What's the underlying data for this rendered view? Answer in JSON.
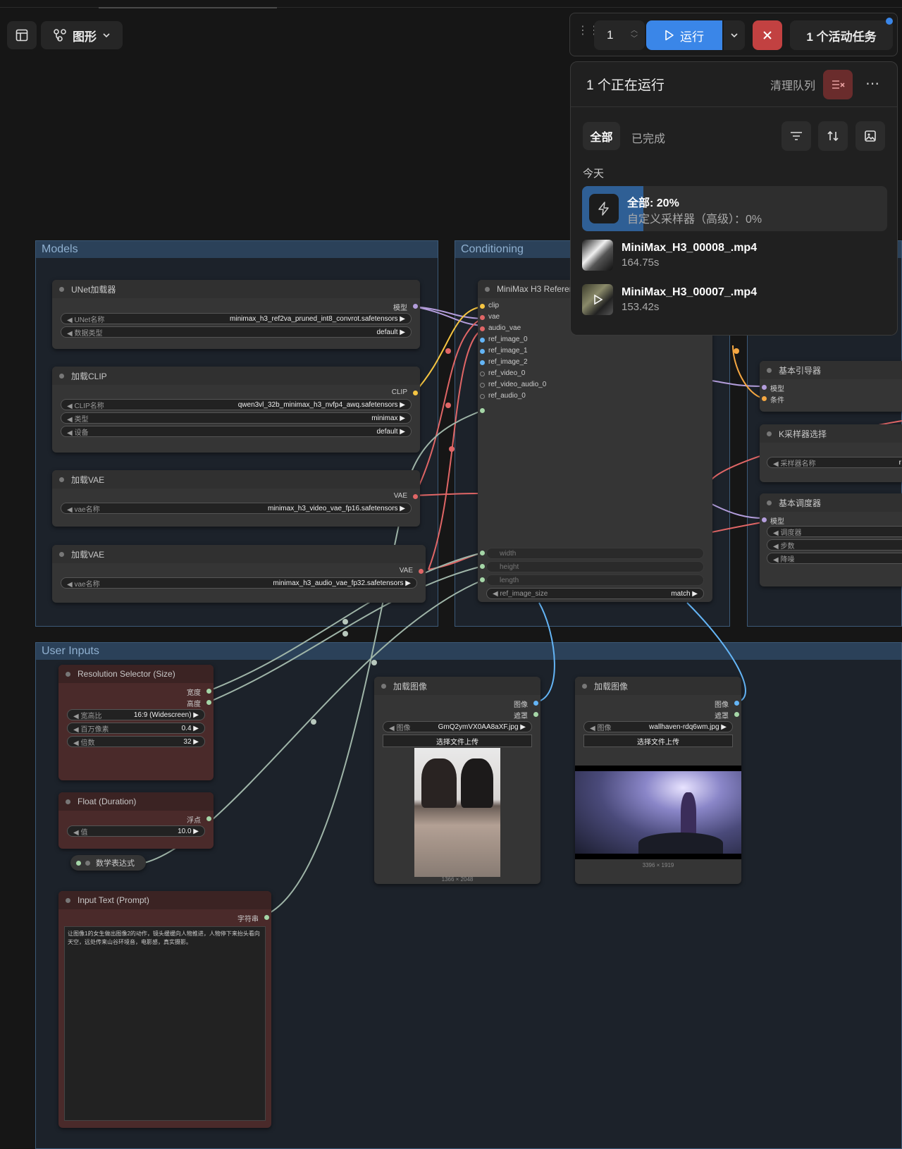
{
  "toolbar": {
    "view_label": "图形",
    "batch_count": "1",
    "run_label": "运行",
    "active_tasks": "1 个活动任务"
  },
  "queue": {
    "title": "1 个正在运行",
    "clear_label": "清理队列",
    "tabs": [
      "全部",
      "已完成"
    ],
    "section": "今天",
    "running": {
      "title": "全部: 20%",
      "subtitle": "自定义采样器（高级）：0%",
      "progress": 0.2
    },
    "items": [
      {
        "name": "MiniMax_H3_00008_.mp4",
        "time": "164.75s"
      },
      {
        "name": "MiniMax_H3_00007_.mp4",
        "time": "153.42s"
      }
    ]
  },
  "groups": {
    "models": "Models",
    "conditioning": "Conditioning",
    "user_inputs": "User Inputs"
  },
  "nodes": {
    "unet": {
      "title": "UNet加载器",
      "out": "模型",
      "w1l": "UNet名称",
      "w1v": "minimax_h3_ref2va_pruned_int8_convrot.safetensors",
      "w2l": "数据类型",
      "w2v": "default"
    },
    "clip": {
      "title": "加载CLIP",
      "out": "CLIP",
      "w1l": "CLIP名称",
      "w1v": "qwen3vl_32b_minimax_h3_nvfp4_awq.safetensors",
      "w2l": "类型",
      "w2v": "minimax",
      "w3l": "设备",
      "w3v": "default"
    },
    "vae1": {
      "title": "加载VAE",
      "out": "VAE",
      "w1l": "vae名称",
      "w1v": "minimax_h3_video_vae_fp16.safetensors"
    },
    "vae2": {
      "title": "加载VAE",
      "out": "VAE",
      "w1l": "vae名称",
      "w1v": "minimax_h3_audio_vae_fp32.safetensors"
    },
    "minimax": {
      "title": "MiniMax H3 Referen",
      "inputs": [
        "clip",
        "vae",
        "audio_vae",
        "ref_image_0",
        "ref_image_1",
        "ref_image_2",
        "ref_video_0",
        "ref_video_audio_0",
        "ref_audio_0"
      ],
      "w_width": "width",
      "w_height": "height",
      "w_length": "length",
      "w_ref": "ref_image_size",
      "w_ref_v": "match"
    },
    "guider": {
      "title": "基本引导器",
      "in1": "模型",
      "in2": "条件"
    },
    "ksampler": {
      "title": "K采样器选择",
      "w1l": "采样器名称",
      "w1v": "r"
    },
    "scheduler": {
      "title": "基本调度器",
      "in1": "模型",
      "w1": "调度器",
      "w2": "步数",
      "w3": "降噪"
    },
    "resolution": {
      "title": "Resolution Selector (Size)",
      "out1": "宽度",
      "out2": "高度",
      "w1l": "宽高比",
      "w1v": "16:9 (Widescreen)",
      "w2l": "百万像素",
      "w2v": "0.4",
      "w3l": "倍数",
      "w3v": "32"
    },
    "float": {
      "title": "Float (Duration)",
      "out": "浮点",
      "w1l": "值",
      "w1v": "10.0"
    },
    "math": {
      "title": "数学表达式"
    },
    "prompt": {
      "title": "Input Text (Prompt)",
      "out": "字符串",
      "text": "让图像1的女生做出图像2的动作，镜头缓缓向人物推进，人物停下来抬头看向天空，远处传来山谷环境音，电影感，真实摄影。"
    },
    "img1": {
      "title": "加载图像",
      "out1": "图像",
      "out2": "遮罩",
      "w1l": "图像",
      "w1v": "GmQ2ymVX0AA8aXF.jpg",
      "upload": "选择文件上传",
      "size": "1366 × 2048"
    },
    "img2": {
      "title": "加载图像",
      "out1": "图像",
      "out2": "遮罩",
      "w1l": "图像",
      "w1v": "wallhaven-rdq6wm.jpg",
      "upload": "选择文件上传",
      "size": "3396 × 1919"
    }
  },
  "colors": {
    "run": "#3a86e8",
    "stop": "#c24141",
    "wire_clip": "#f5c542",
    "wire_vae": "#e06666",
    "wire_model": "#b39ddb",
    "wire_image": "#64b5f6",
    "wire_float": "#a5d6a7"
  }
}
